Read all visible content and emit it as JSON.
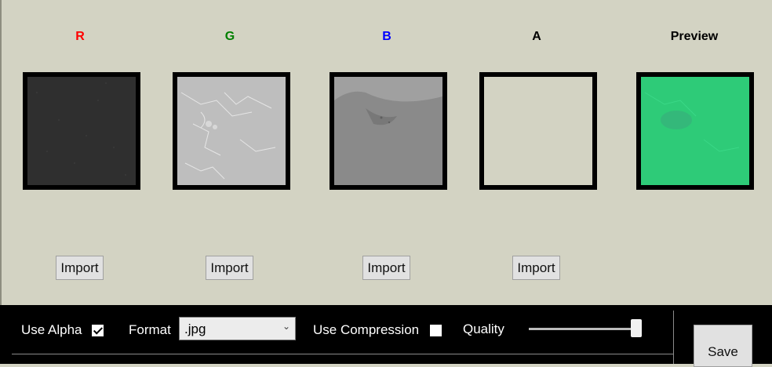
{
  "channels": {
    "r": {
      "label": "R",
      "color": "#ff0000",
      "import_label": "Import"
    },
    "g": {
      "label": "G",
      "color": "#007f00",
      "import_label": "Import"
    },
    "b": {
      "label": "B",
      "color": "#0000ff",
      "import_label": "Import"
    },
    "a": {
      "label": "A",
      "color": "#000000",
      "import_label": "Import"
    }
  },
  "preview": {
    "label": "Preview"
  },
  "footer": {
    "use_alpha_label": "Use Alpha",
    "use_alpha_checked": true,
    "format_label": "Format",
    "format_value": ".jpg",
    "use_compression_label": "Use Compression",
    "use_compression_checked": false,
    "quality_label": "Quality",
    "quality_value": 1.0,
    "save_label": "Save"
  }
}
